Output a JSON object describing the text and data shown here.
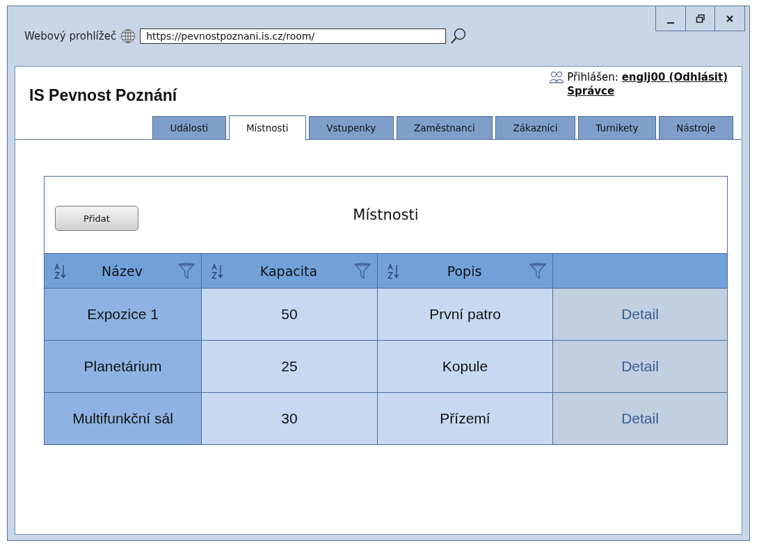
{
  "browser": {
    "title": "Webový prohlížeč",
    "url": "https://pevnostpoznani.is.cz/room/"
  },
  "app": {
    "title": "IS Pevnost Poznání",
    "user_label": "Přihlášen:",
    "user_link": "englj00 (Odhlásit)",
    "role": "Správce"
  },
  "tabs": [
    {
      "label": "Události",
      "selected": false
    },
    {
      "label": "Místnosti",
      "selected": true
    },
    {
      "label": "Vstupenky",
      "selected": false
    },
    {
      "label": "Zaměstnanci",
      "selected": false
    },
    {
      "label": "Zákazníci",
      "selected": false
    },
    {
      "label": "Turnikety",
      "selected": false
    },
    {
      "label": "Nástroje",
      "selected": false
    }
  ],
  "panel": {
    "title": "Místnosti",
    "add_button": "Přidat"
  },
  "table": {
    "columns": [
      {
        "label": "Název",
        "kind": "sortable"
      },
      {
        "label": "Kapacita",
        "kind": "sortable"
      },
      {
        "label": "Popis",
        "kind": "sortable"
      },
      {
        "kind": "plain"
      }
    ],
    "rows": [
      {
        "name": "Expozice 1",
        "capacity": "50",
        "description": "První patro",
        "action": "Detail"
      },
      {
        "name": "Planetárium",
        "capacity": "25",
        "description": "Kopule",
        "action": "Detail"
      },
      {
        "name": "Multifunkční sál",
        "capacity": "30",
        "description": "Přízemí",
        "action": "Detail"
      }
    ]
  }
}
